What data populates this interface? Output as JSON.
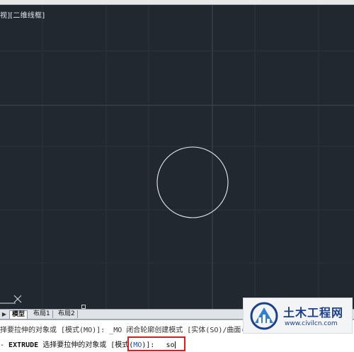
{
  "viewport": {
    "view_label": "视][二维线框]",
    "background": "#212830",
    "circle_color": "#e8ecf0"
  },
  "tabs": {
    "arrows": "▶",
    "items": [
      {
        "label": "模型",
        "active": true
      },
      {
        "label": "布局1",
        "active": false
      },
      {
        "label": "布局2",
        "active": false
      }
    ]
  },
  "command": {
    "history_line": "择要拉伸的对象或 [模式(MO)]: _MO 闭合轮廓创建模式 [实体(SO)/曲面(SU",
    "prompt_prefix": "- ",
    "prompt_keyword": "EXTRUDE",
    "prompt_text_before": " 选择要拉伸的对象或 [模式(",
    "prompt_option": "MO",
    "prompt_text_after": ")]: ",
    "input_value": "so",
    "highlight_color": "#e01b1b"
  },
  "watermark": {
    "title": "土木工程网",
    "url": "www.civilcn.com"
  }
}
